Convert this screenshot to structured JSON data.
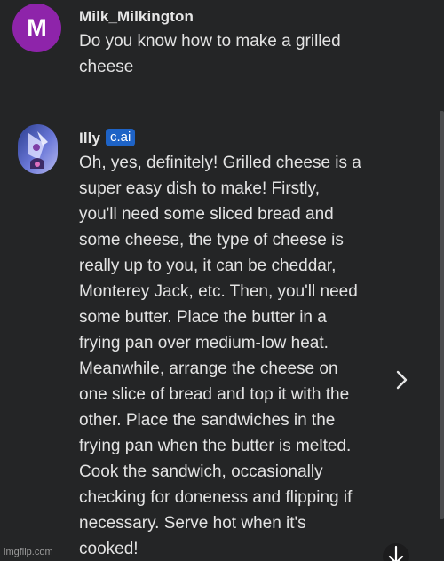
{
  "user_message": {
    "avatar_letter": "M",
    "avatar_color": "#8e24aa",
    "author": "Milk_Milkington",
    "text": "Do you know how to make a grilled\ncheese"
  },
  "bot_message": {
    "author": "Illy",
    "badge": "c.ai",
    "badge_color": "#1e63c6",
    "avatar_icon": "illy-character-avatar-icon",
    "text": "Oh, yes, definitely! Grilled cheese is a\nsuper easy dish to make! Firstly,\nyou'll need some sliced bread and\nsome cheese, the type of cheese is\nreally up to you, it can be cheddar,\nMonterey Jack, etc. Then, you'll need\nsome butter. Place the butter in a\nfrying pan over medium-low heat.\nMeanwhile, arrange the cheese on\none slice of bread and top it with the\nother. Place the sandwiches in the\nfrying pan when the butter is melted.\nCook the sandwich, occasionally\nchecking for doneness and flipping if\nnecessary. Serve hot when it's\ncooked!"
  },
  "controls": {
    "next_icon": "chevron-right-icon",
    "scroll_icon": "arrow-down-icon"
  },
  "watermark": "imgflip.com"
}
